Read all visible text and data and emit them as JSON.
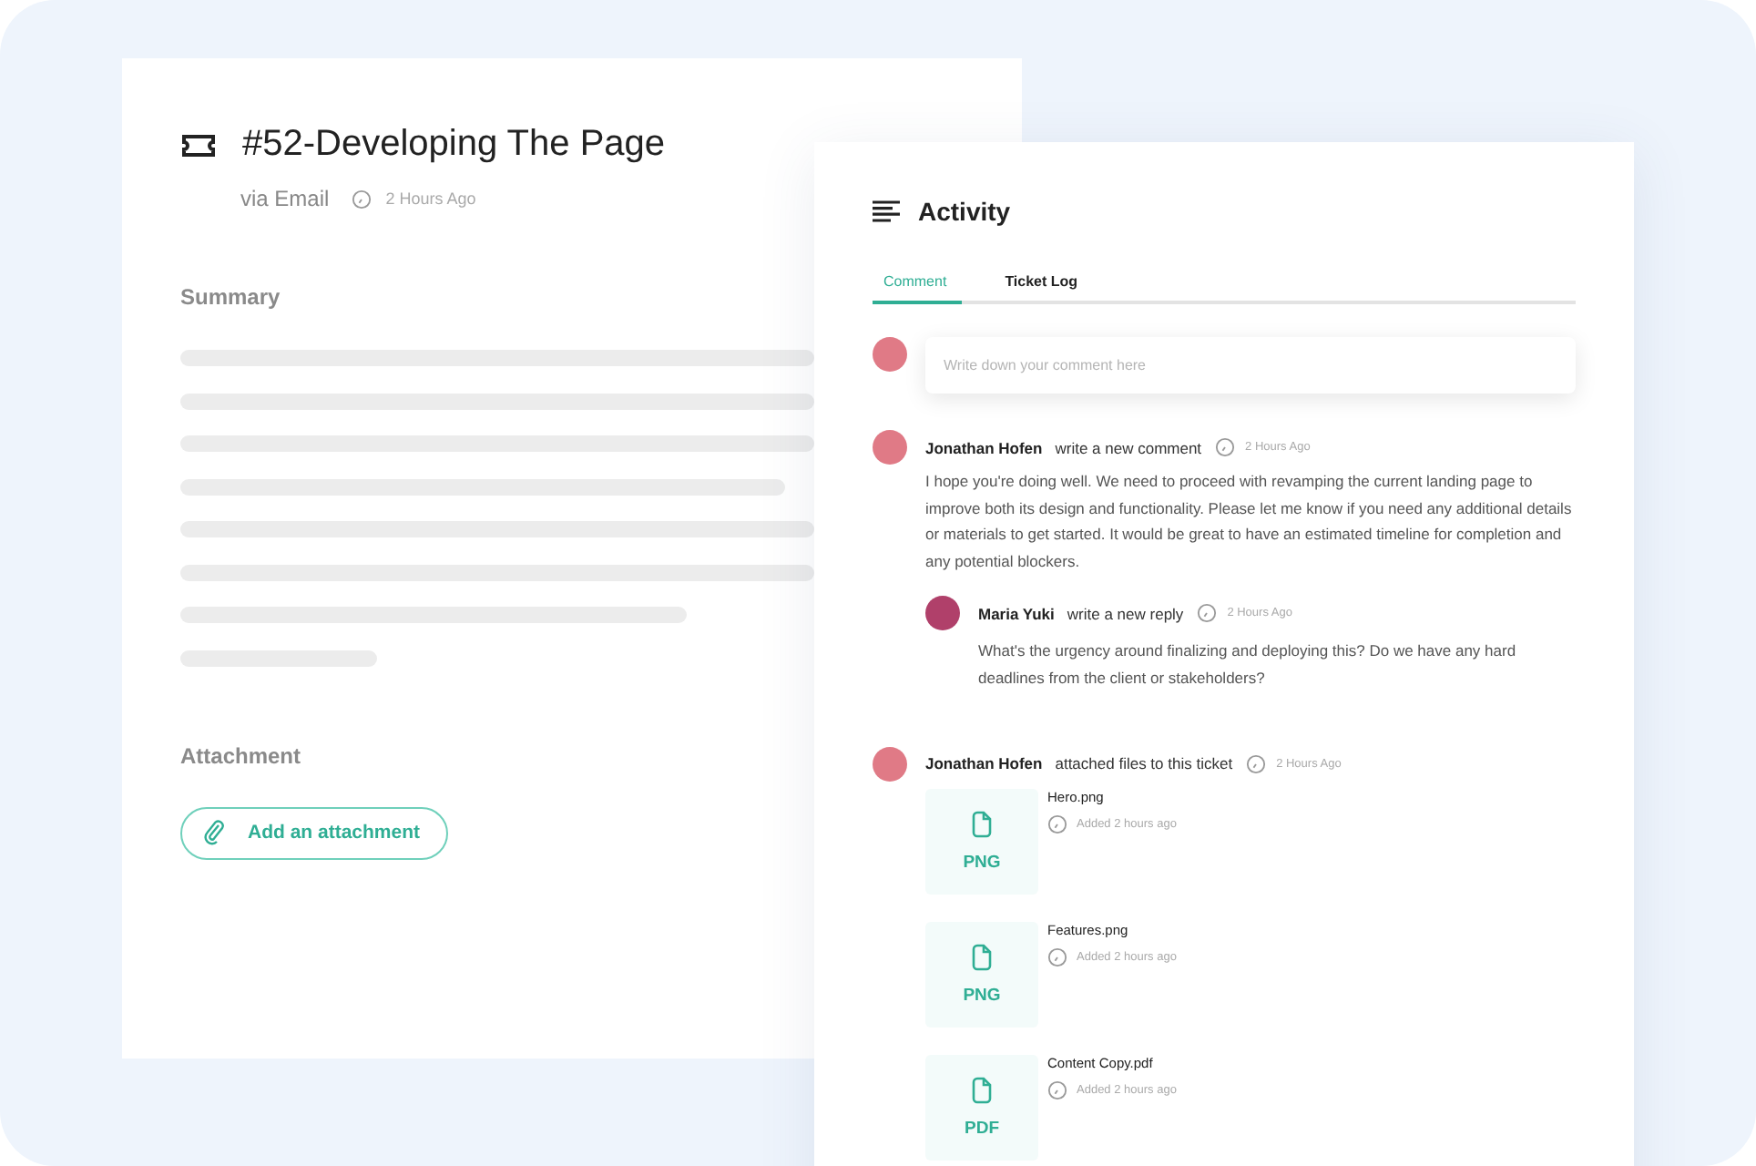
{
  "ticket": {
    "title": "#52-Developing The Page",
    "source": "via Email",
    "time": "2 Hours Ago",
    "summary_label": "Summary",
    "attachment_label": "Attachment",
    "attach_button": "Add an attachment"
  },
  "activity": {
    "title": "Activity",
    "tabs": [
      {
        "label": "Comment",
        "selected": true
      },
      {
        "label": "Ticket Log",
        "selected": false
      }
    ],
    "comment_field": {
      "placeholder": "Write down your comment here"
    },
    "entries": [
      {
        "kind": "comment",
        "author": "Jonathan Hofen",
        "action": "write a new comment",
        "time": "2 Hours Ago",
        "text": "I hope you're doing well. We need to proceed with revamping the current landing page to improve both its design and functionality. Please let me know if you need any additional details or materials to get started. It would be great to have an estimated timeline for completion and any potential blockers.",
        "replies": [
          {
            "author": "Maria Yuki",
            "action": "write a new reply",
            "time": "2 Hours Ago",
            "text": "What's the urgency around finalizing and deploying this? Do we have any hard deadlines from the client or stakeholders?"
          }
        ]
      },
      {
        "kind": "files",
        "author": "Jonathan Hofen",
        "action": "attached files to this ticket",
        "time": "2 Hours Ago",
        "files": [
          {
            "type": "PNG",
            "name": "Hero.png",
            "added": "Added 2 hours ago"
          },
          {
            "type": "PNG",
            "name": "Features.png",
            "added": "Added 2 hours ago"
          },
          {
            "type": "PDF",
            "name": "Content Copy.pdf",
            "added": "Added 2 hours ago"
          }
        ]
      }
    ]
  }
}
